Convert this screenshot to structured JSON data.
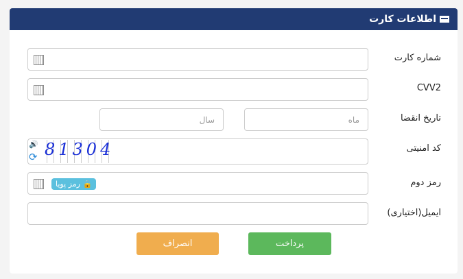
{
  "header": {
    "title": "اطلاعات کارت",
    "icon": "credit-card-icon"
  },
  "fields": {
    "card_number": "شماره کارت",
    "cvv2": "CVV2",
    "expiry": "تاریخ انقضا",
    "month_placeholder": "ماه",
    "year_placeholder": "سال",
    "captcha": "کد امنیتی",
    "captcha_text": "81304",
    "second_pin": "رمز دوم",
    "dynamic_pin": "رمز پویا",
    "email": "ایمیل(اختیاری)"
  },
  "buttons": {
    "pay": "پرداخت",
    "cancel": "انصراف"
  }
}
